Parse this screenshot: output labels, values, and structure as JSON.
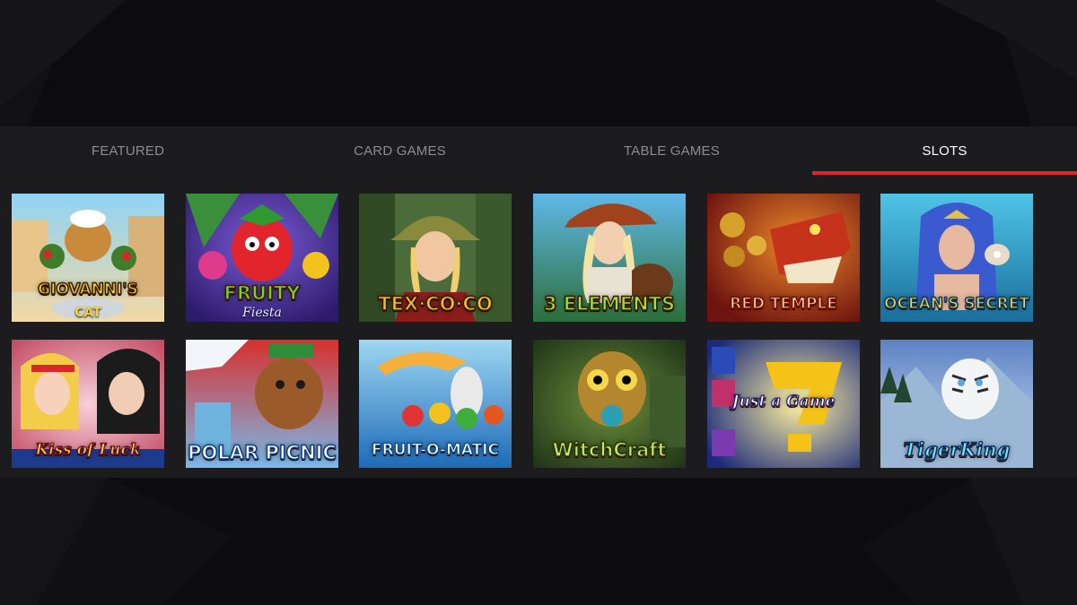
{
  "tabs": [
    {
      "label": "FEATURED",
      "active": false
    },
    {
      "label": "CARD GAMES",
      "active": false
    },
    {
      "label": "TABLE GAMES",
      "active": false
    },
    {
      "label": "SLOTS",
      "active": true
    }
  ],
  "colors": {
    "accent": "#e2232a",
    "page_background": "#0c0c0e",
    "panel_background": "#1c1c1e",
    "tab_text": "#8d8d8f",
    "tab_text_active": "#ffffff"
  },
  "games": [
    {
      "title": "GIOVANNI'S",
      "subtitle": "CAT"
    },
    {
      "title": "FRUITY",
      "subtitle": "Fiesta"
    },
    {
      "title": "TEX·CO·CO",
      "subtitle": ""
    },
    {
      "title": "3 ELEMENTS",
      "subtitle": ""
    },
    {
      "title": "RED TEMPLE",
      "subtitle": ""
    },
    {
      "title": "OCEAN'S SECRET",
      "subtitle": ""
    },
    {
      "title": "Kiss of Luck",
      "subtitle": ""
    },
    {
      "title": "POLAR PICNIC",
      "subtitle": ""
    },
    {
      "title": "FRUIT-O-MATIC",
      "subtitle": ""
    },
    {
      "title": "WitchCraft",
      "subtitle": ""
    },
    {
      "title": "Just a Game",
      "subtitle": ""
    },
    {
      "title": "TigerKing",
      "subtitle": ""
    }
  ]
}
